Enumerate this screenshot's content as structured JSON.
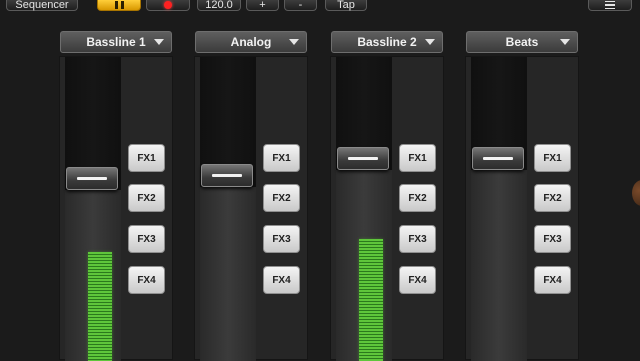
{
  "toolbar": {
    "sequencer_label": "Sequencer",
    "tempo_value": "120.0",
    "plus_label": "+",
    "minus_label": "-",
    "tap_label": "Tap",
    "pause_state": "active",
    "accent_color": "#f2b400",
    "record_color": "#ff2020"
  },
  "channels": [
    {
      "name": "Bassline 1",
      "fader_level": 0.61,
      "meter_level": 0.36,
      "fx": [
        "FX1",
        "FX2",
        "FX3",
        "FX4"
      ]
    },
    {
      "name": "Analog",
      "fader_level": 0.62,
      "meter_level": 0.0,
      "fx": [
        "FX1",
        "FX2",
        "FX3",
        "FX4"
      ]
    },
    {
      "name": "Bassline 2",
      "fader_level": 0.68,
      "meter_level": 0.4,
      "fx": [
        "FX1",
        "FX2",
        "FX3",
        "FX4"
      ]
    },
    {
      "name": "Beats",
      "fader_level": 0.68,
      "meter_level": 0.0,
      "fx": [
        "FX1",
        "FX2",
        "FX3",
        "FX4"
      ]
    }
  ]
}
